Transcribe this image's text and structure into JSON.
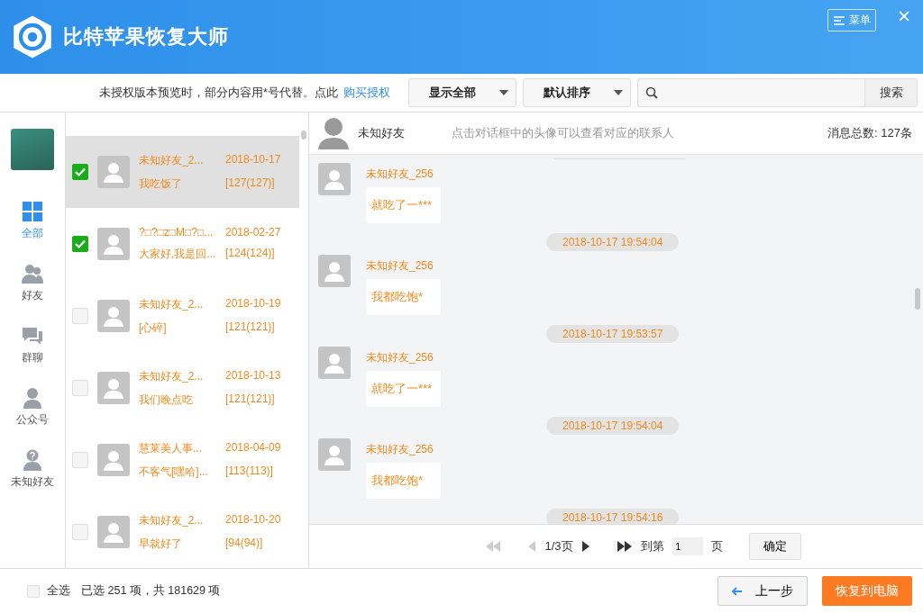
{
  "window": {
    "title": "比特苹果恢复大师",
    "menu_button": "菜单",
    "close_button": "×"
  },
  "notice": {
    "text": "未授权版本预览时，部分内容用*号代替。点此",
    "link": "购买授权"
  },
  "filters": [
    {
      "label": "显示全部"
    },
    {
      "label": "默认排序"
    }
  ],
  "search": {
    "button": "搜索"
  },
  "nav": [
    {
      "label": "全部",
      "selected": true
    },
    {
      "label": "好友",
      "selected": false
    },
    {
      "label": "群聊",
      "selected": false
    },
    {
      "label": "公众号",
      "selected": false
    },
    {
      "label": "未知好友",
      "selected": false
    }
  ],
  "contacts": [
    {
      "name": "未知好友_2...",
      "date": "2018-10-17",
      "preview": "我吃饭了",
      "count": "[127(127)]",
      "checked": true,
      "selected": true
    },
    {
      "name": "?□?□z□M□?□...",
      "date": "2018-02-27",
      "preview": "大家好,我是回...",
      "count": "[124(124)]",
      "checked": true,
      "selected": false
    },
    {
      "name": "未知好友_2...",
      "date": "2018-10-19",
      "preview": "[心碎]",
      "count": "[121(121)]",
      "checked": false,
      "selected": false
    },
    {
      "name": "未知好友_2...",
      "date": "2018-10-13",
      "preview": "我们晚点吃",
      "count": "[121(121)]",
      "checked": false,
      "selected": false
    },
    {
      "name": "慧莱美人事...",
      "date": "2018-04-09",
      "preview": "不客气[嘿哈]...",
      "count": "[113(113)]",
      "checked": false,
      "selected": false
    },
    {
      "name": "未知好友_2...",
      "date": "2018-10-20",
      "preview": "早就好了",
      "count": "[94(94)]",
      "checked": false,
      "selected": false
    }
  ],
  "chat": {
    "contact": "未知好友",
    "hint": "点击对话框中的头像可以查看对应的联系人",
    "total": "消息总数: 127条",
    "messages": [
      {
        "kind": "message",
        "sender": "未知好友_256",
        "text": "就吃了一***"
      },
      {
        "kind": "time",
        "text": "2018-10-17 19:54:04"
      },
      {
        "kind": "message",
        "sender": "未知好友_256",
        "text": "我都吃饱*"
      },
      {
        "kind": "time",
        "text": "2018-10-17 19:53:57"
      },
      {
        "kind": "message",
        "sender": "未知好友_256",
        "text": "就吃了一***"
      },
      {
        "kind": "time",
        "text": "2018-10-17 19:54:04"
      },
      {
        "kind": "message",
        "sender": "未知好友_256",
        "text": "我都吃饱*"
      },
      {
        "kind": "time",
        "text": "2018-10-17 19:54:16"
      }
    ]
  },
  "pager": {
    "page": "1/3页",
    "goto_label": "到第",
    "goto_value": "1",
    "unit": "页",
    "confirm": "确定"
  },
  "footer": {
    "select_all": {
      "label": "全选",
      "checked": false
    },
    "summary": "已选 251 项，共 181629 项",
    "back": "上一步",
    "restore": "恢复到电脑"
  }
}
